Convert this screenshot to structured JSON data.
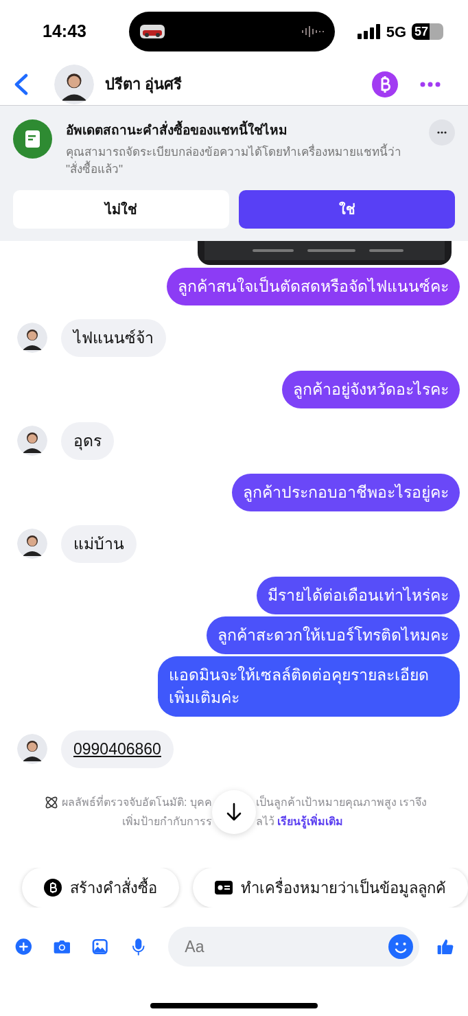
{
  "status_bar": {
    "time": "14:43",
    "network": "5G",
    "battery": "57"
  },
  "header": {
    "contact_name": "ปรีตา อุ่นศรี"
  },
  "banner": {
    "title": "อัพเดตสถานะคำสั่งซื้อของแชทนี้ใช่ไหม",
    "description": "คุณสามารถจัดระเบียบกล่องข้อความได้โดยทำเครื่องหมายแชทนี้ว่า \"สั่งซื้อแล้ว\"",
    "buttons": [
      {
        "label": "ไม่ใช่",
        "primary": false
      },
      {
        "label": "ใช่",
        "primary": true
      }
    ]
  },
  "messages": [
    {
      "kind": "sent",
      "text": "ลูกค้าสนใจเป็นตัดสดหรือจัดไฟแนนซ์คะ",
      "color": "#8c3cf5"
    },
    {
      "kind": "received",
      "text": "ไฟแนนซ์จ้า"
    },
    {
      "kind": "sent",
      "text": "ลูกค้าอยู่จังหวัดอะไรคะ",
      "color": "#7e42f7"
    },
    {
      "kind": "received",
      "text": "อุดร"
    },
    {
      "kind": "sent",
      "text": "ลูกค้าประกอบอาชีพอะไรอยู่คะ",
      "color": "#6a48f8"
    },
    {
      "kind": "received",
      "text": "แม่บ้าน"
    },
    {
      "kind": "sent",
      "text": "มีรายได้ต่อเดือนเท่าไหร่คะ",
      "color": "#574ef9"
    },
    {
      "kind": "sent",
      "text": "ลูกค้าสะดวกให้เบอร์โทรติดไหมคะ",
      "color": "#4b52fa"
    },
    {
      "kind": "sent",
      "text": "แอดมินจะให้เซลล์ติดต่อคุยรายละเอียดเพิ่มเติมค่ะ",
      "color": "#3f58fb"
    },
    {
      "kind": "received",
      "text": "0990406860",
      "link": true
    }
  ],
  "notice": {
    "line1_left": "ผลลัพธ์ที่ตรวจจับอัตโนมัติ: บุคค",
    "line1_right": "เป็นลูกค้าเป้าหมายคุณภาพสูง เราจึง",
    "line2_left": "เพิ่มป้ายกำกับการร",
    "line2_right": "ลไว้",
    "link": "เรียนรู้เพิ่มเติม"
  },
  "quick_actions": [
    {
      "kind": "order",
      "label": "สร้างคำสั่งซื้อ"
    },
    {
      "kind": "tag",
      "label": "ทำเครื่องหมายว่าเป็นข้อมูลลูกค้"
    }
  ],
  "composer": {
    "placeholder": "Aa"
  }
}
